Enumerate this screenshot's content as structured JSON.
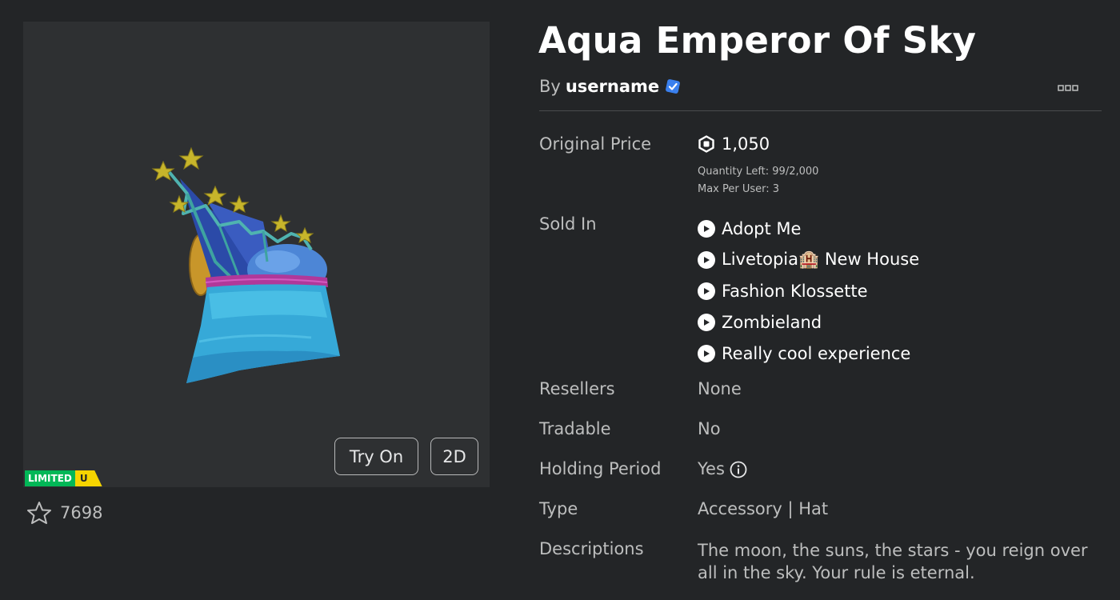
{
  "item": {
    "title": "Aqua Emperor Of Sky",
    "by_prefix": "By",
    "creator": "username",
    "verified_icon": "verified-badge-icon"
  },
  "preview": {
    "try_on_label": "Try On",
    "view_2d_label": "2D",
    "limited_label": "LIMITED",
    "unique_label": "U",
    "favorites_count": "7698",
    "colors": {
      "limited": "#02b757",
      "unique": "#f6d400"
    }
  },
  "details": {
    "original_price_label": "Original Price",
    "price": "1,050",
    "currency_icon": "robux-icon",
    "quantity_left": "Quantity Left: 99/2,000",
    "max_per_user": "Max Per User: 3",
    "sold_in_label": "Sold In",
    "sold_in": [
      "Adopt Me",
      "Livetopia🏨 New House",
      "Fashion Klossette",
      "Zombieland",
      "Really cool experience"
    ],
    "resellers_label": "Resellers",
    "resellers_value": "None",
    "tradable_label": "Tradable",
    "tradable_value": "No",
    "holding_period_label": "Holding Period",
    "holding_period_value": "Yes",
    "type_label": "Type",
    "type_value": "Accessory | Hat",
    "descriptions_label": "Descriptions",
    "description": "The moon, the suns, the stars - you reign over all in the sky. Your rule is eternal."
  }
}
